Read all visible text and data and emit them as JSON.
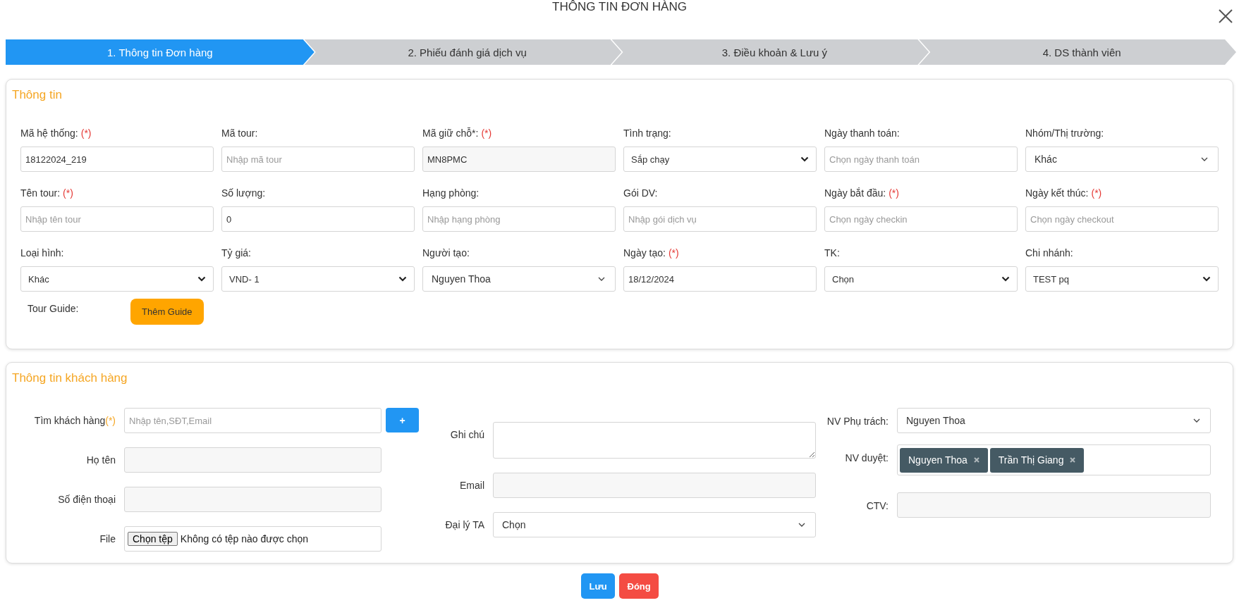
{
  "dialog": {
    "title": "THÔNG TIN ĐƠN HÀNG"
  },
  "steps": [
    {
      "label": "1. Thông tin Đơn hàng",
      "selected": true
    },
    {
      "label": "2. Phiếu đánh giá dịch vụ",
      "selected": false
    },
    {
      "label": "3. Điều khoản & Lưu ý",
      "selected": false
    },
    {
      "label": "4. DS thành viên",
      "selected": false
    }
  ],
  "order_info": {
    "title": "Thông tin",
    "fields": [
      {
        "label": "Mã hệ thống:",
        "required": "(*)",
        "kind": "input",
        "value": "18122024_219"
      },
      {
        "label": "Mã tour:",
        "kind": "input",
        "placeholder": "Nhập mã tour"
      },
      {
        "label": "Mã giữ chỗ*:",
        "required": "(*)",
        "kind": "readonly",
        "value": "MN8PMC"
      },
      {
        "label": "Tình trạng:",
        "kind": "select",
        "value": "Sắp chạy"
      },
      {
        "label": "Ngày thanh toán:",
        "kind": "input",
        "placeholder": "Chọn ngày thanh toán"
      },
      {
        "label": "Nhóm/Thị trường:",
        "kind": "combo",
        "value": "Khác"
      },
      {
        "label": "Tên tour:",
        "required": "(*)",
        "kind": "input",
        "placeholder": "Nhập tên tour"
      },
      {
        "label": "Số lượng:",
        "kind": "input",
        "value": "0"
      },
      {
        "label": "Hạng phòng:",
        "kind": "input",
        "placeholder": "Nhập hạng phòng"
      },
      {
        "label": "Gói DV:",
        "kind": "input",
        "placeholder": "Nhập gói dịch vụ"
      },
      {
        "label": "Ngày bắt đầu:",
        "required": "(*)",
        "kind": "input",
        "placeholder": "Chọn ngày checkin"
      },
      {
        "label": "Ngày kết thúc:",
        "required": "(*)",
        "kind": "input",
        "placeholder": "Chọn ngày checkout"
      },
      {
        "label": "Loại hình:",
        "kind": "select",
        "value": "Khác"
      },
      {
        "label": "Tỷ giá:",
        "kind": "select",
        "value": "VND- 1"
      },
      {
        "label": "Người tạo:",
        "kind": "combo",
        "value": "Nguyen Thoa"
      },
      {
        "label": "Ngày tạo:",
        "required": "(*)",
        "kind": "input",
        "value": "18/12/2024"
      },
      {
        "label": "TK:",
        "kind": "select",
        "value": "Chọn"
      },
      {
        "label": "Chi nhánh:",
        "kind": "select",
        "value": "TEST pq"
      }
    ],
    "tour_guide": {
      "label": "Tour Guide:",
      "button": "Thêm Guide"
    }
  },
  "customer_info": {
    "title": "Thông tin khách hàng",
    "columns": [
      [
        {
          "label": "Tìm khách hàng",
          "required": "(*)",
          "kind": "search",
          "placeholder": "Nhập tên,SĐT,Email",
          "button": "+"
        },
        {
          "label": "Họ tên",
          "kind": "readonly"
        },
        {
          "label": "Số điện thoại",
          "kind": "readonly"
        },
        {
          "label": "File",
          "kind": "file",
          "button": "Chọn tệp",
          "value": "Không có tệp nào được chọn"
        }
      ],
      [
        {
          "label": "Ghi chú",
          "kind": "textarea"
        },
        {
          "label": "Email",
          "kind": "readonly"
        },
        {
          "label": "Đại lý TA",
          "kind": "combo",
          "value": "Chọn"
        }
      ],
      [
        {
          "label": "NV Phụ trách:",
          "kind": "combo",
          "value": "Nguyen Thoa"
        },
        {
          "label": "NV duyệt:",
          "kind": "tags",
          "tags": [
            "Nguyen Thoa",
            "Trần Thị Giang"
          ]
        },
        {
          "label": "CTV:",
          "kind": "readonly"
        }
      ]
    ]
  },
  "buttons": [
    {
      "label": "Lưu",
      "kind": "primary"
    },
    {
      "label": "Đóng",
      "kind": "danger"
    }
  ]
}
